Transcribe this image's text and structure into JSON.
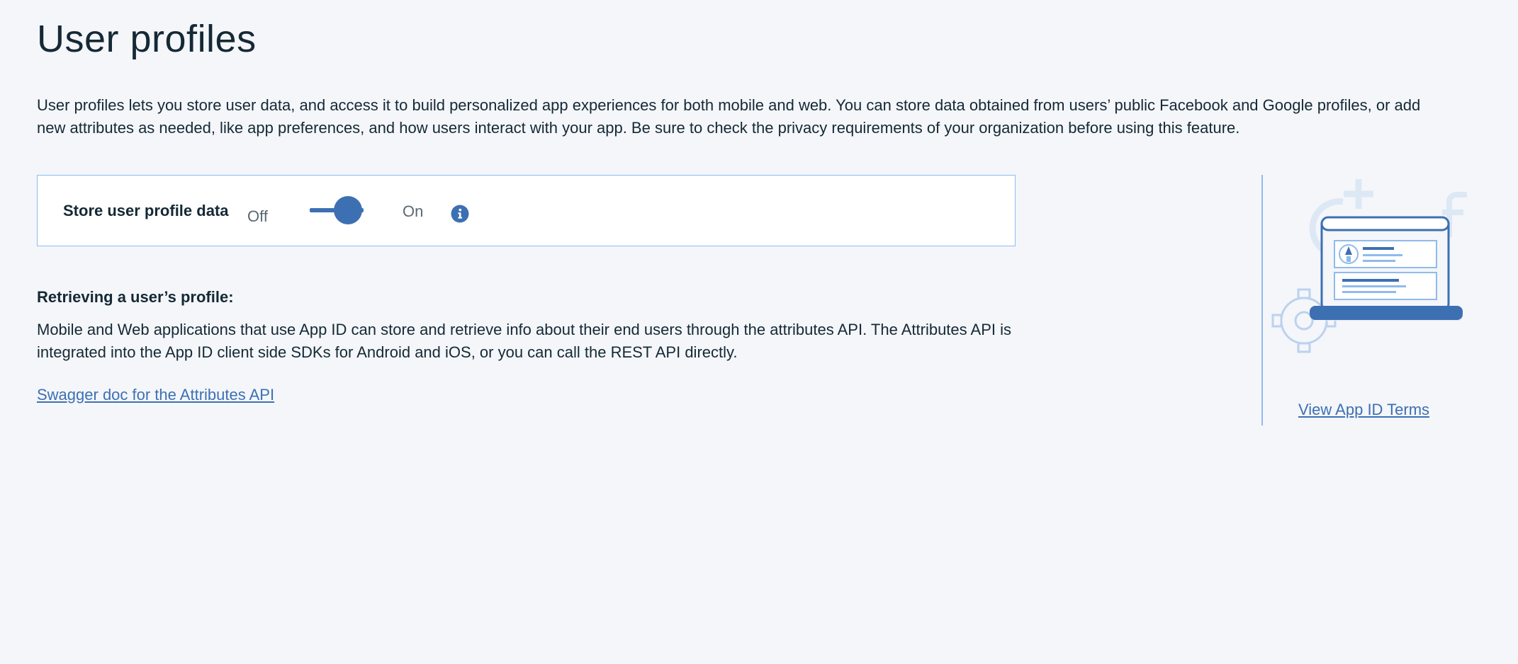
{
  "page": {
    "title": "User profiles",
    "intro": "User profiles lets you store user data, and access it to build personalized app experiences for both mobile and web. You can store data obtained from users’ public Facebook and Google profiles, or add new attributes as needed, like app preferences, and how users interact with your app. Be sure to check the privacy requirements of your organization before using this feature."
  },
  "store_toggle": {
    "label": "Store user profile data",
    "off_label": "Off",
    "on_label": "On",
    "state": "on",
    "info_icon": "info-icon"
  },
  "retrieving": {
    "heading": "Retrieving a user’s profile:",
    "body": "Mobile and Web applications that use App ID can store and retrieve info about their end users through the attributes API. The Attributes API is integrated into the App ID client side SDKs for Android and iOS, or you can call the REST API directly.",
    "link_label": "Swagger doc for the Attributes API"
  },
  "sidebar": {
    "illustration": "laptop-profile-illustration",
    "terms_link_label": "View App ID Terms"
  },
  "colors": {
    "accent": "#3d70b2",
    "border": "#8fbbec",
    "background": "#f4f6fa",
    "text": "#152935"
  }
}
